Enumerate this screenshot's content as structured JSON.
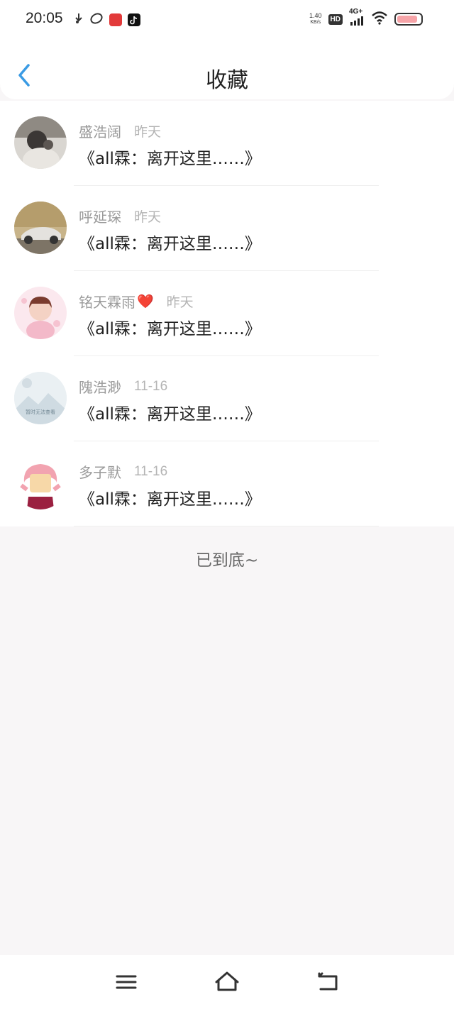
{
  "status_bar": {
    "time": "20:05",
    "net_speed_value": "1.40",
    "net_speed_unit": "KB/s",
    "hd_label": "HD",
    "network_label": "4G+",
    "battery_color": "#f6a4a8"
  },
  "header": {
    "title": "收藏",
    "accent_color": "#3a9be4"
  },
  "items": [
    {
      "name": "盛浩阔",
      "date": "昨天",
      "content": "《all霖：离开这里……》"
    },
    {
      "name": "呼延琛",
      "date": "昨天",
      "content": "《all霖：离开这里……》"
    },
    {
      "name": "铭天霖雨",
      "date": "昨天",
      "content": "《all霖：离开这里……》"
    },
    {
      "name": "隗浩渺",
      "date": "11-16",
      "content": "《all霖：离开这里……》"
    },
    {
      "name": "多子默",
      "date": "11-16",
      "content": "《all霖：离开这里……》"
    }
  ],
  "item3_emoji": "❤️",
  "avatar4_caption": "暂时无法查看",
  "footer": {
    "end_text": "已到底~"
  },
  "nav": {
    "menu_icon": "menu-icon",
    "home_icon": "home-icon",
    "back_icon": "back-icon"
  }
}
